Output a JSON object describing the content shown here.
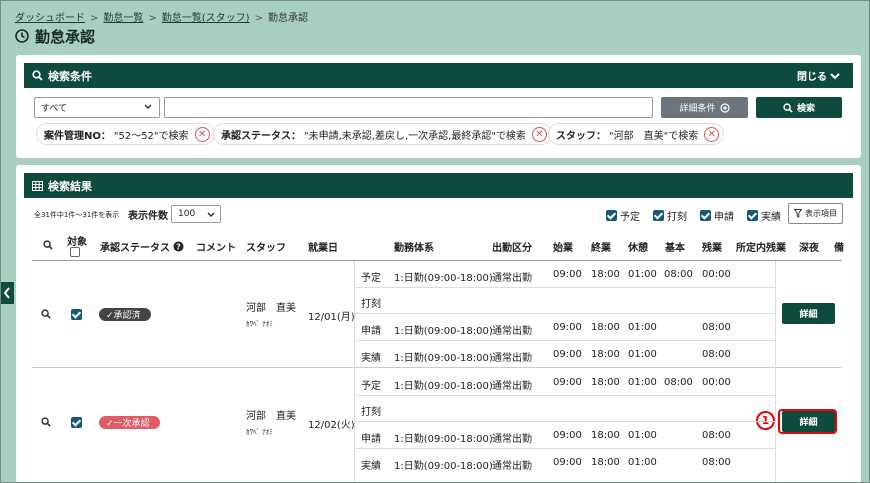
{
  "breadcrumb": {
    "items": [
      "ダッシュボード",
      "勤怠一覧",
      "勤怠一覧(スタッフ)",
      "勤怠承認"
    ]
  },
  "page_title": "勤怠承認",
  "search_panel": {
    "title": "検索条件",
    "close_label": "閉じる",
    "select_value": "すべて",
    "search_input_value": "",
    "advanced_button": "詳細条件",
    "search_button": "検索",
    "tags": [
      {
        "label": "案件管理NO：",
        "value": "\"52〜52\"で検索"
      },
      {
        "label": "承認ステータス：",
        "value": "\"未申請,未承認,差戻し,一次承認,最終承認\"で検索"
      },
      {
        "label": "スタッフ：",
        "value": "\"河部　直美\"で検索"
      }
    ]
  },
  "results_panel": {
    "title": "検索結果",
    "count_text": "全31件中1件～31件を表示",
    "per_page_label": "表示件数",
    "per_page_value": "100",
    "filters": [
      "予定",
      "打刻",
      "申請",
      "実績"
    ],
    "columns_button": "表示項目",
    "headers": [
      "対象",
      "承認ステータス",
      "コメント",
      "スタッフ",
      "就業日",
      "勤務体系",
      "出勤区分",
      "始業",
      "終業",
      "休憩",
      "基本",
      "残業",
      "所定内残業",
      "深夜",
      "備"
    ],
    "rows": [
      {
        "status": "✓承認済",
        "staff_name": "河部　直美",
        "staff_kana": "ｶﾜﾍﾞ ﾅｵﾐ",
        "date": "12/01(月)",
        "detail_button": "詳細",
        "sub": [
          {
            "type": "予定",
            "shift": "1:日勤(09:00-18:00)",
            "kubun": "通常出勤",
            "start": "09:00",
            "end": "18:00",
            "break": "01:00",
            "basic": "08:00",
            "overtime": "00:00"
          },
          {
            "type": "打刻",
            "shift": "",
            "kubun": "",
            "start": "",
            "end": "",
            "break": "",
            "basic": "",
            "overtime": ""
          },
          {
            "type": "申請",
            "shift": "1:日勤(09:00-18:00)",
            "kubun": "通常出勤",
            "start": "09:00",
            "end": "18:00",
            "break": "01:00",
            "basic": "",
            "overtime": "08:00"
          },
          {
            "type": "実績",
            "shift": "1:日勤(09:00-18:00)",
            "kubun": "通常出勤",
            "start": "09:00",
            "end": "18:00",
            "break": "01:00",
            "basic": "",
            "overtime": "08:00"
          }
        ]
      },
      {
        "status": "✓一次承認",
        "staff_name": "河部　直美",
        "staff_kana": "ｶﾜﾍﾞ ﾅｵﾐ",
        "date": "12/02(火)",
        "detail_button": "詳細",
        "sub": [
          {
            "type": "予定",
            "shift": "1:日勤(09:00-18:00)",
            "kubun": "通常出勤",
            "start": "09:00",
            "end": "18:00",
            "break": "01:00",
            "basic": "08:00",
            "overtime": "00:00"
          },
          {
            "type": "打刻",
            "shift": "",
            "kubun": "",
            "start": "",
            "end": "",
            "break": "",
            "basic": "",
            "overtime": ""
          },
          {
            "type": "申請",
            "shift": "1:日勤(09:00-18:00)",
            "kubun": "通常出勤",
            "start": "09:00",
            "end": "18:00",
            "break": "01:00",
            "basic": "",
            "overtime": "08:00"
          },
          {
            "type": "実績",
            "shift": "1:日勤(09:00-18:00)",
            "kubun": "通常出勤",
            "start": "09:00",
            "end": "18:00",
            "break": "01:00",
            "basic": "",
            "overtime": "08:00"
          }
        ]
      }
    ]
  },
  "annotation_number": "1",
  "colors": {
    "brand": "#0f4a3e",
    "background": "#a8cfc0",
    "highlight": "#ee0000"
  }
}
